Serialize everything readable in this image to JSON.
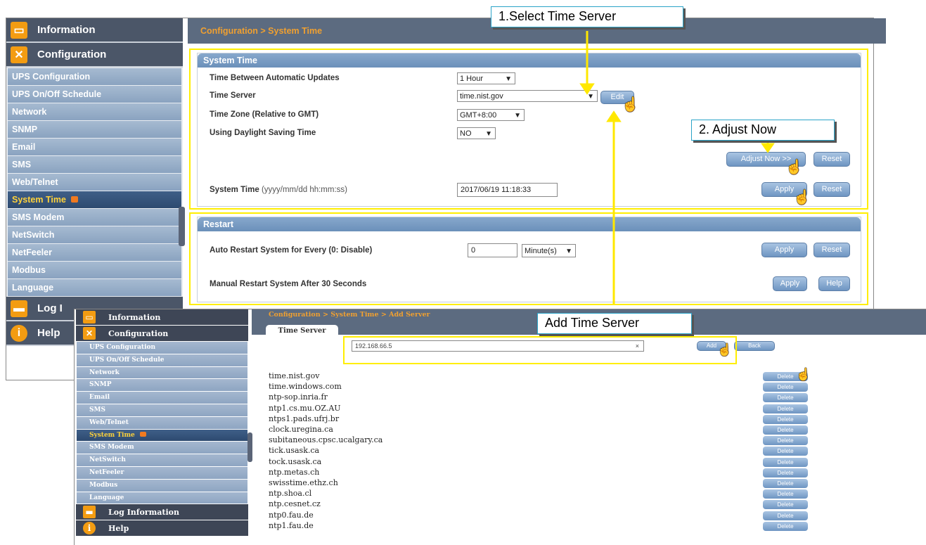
{
  "annotations": {
    "step1": "1.Select Time Server",
    "step2": "2. Adjust Now",
    "step3": "Add Time Server"
  },
  "main_window": {
    "sidebar": {
      "information": "Information",
      "configuration": "Configuration",
      "items": [
        "UPS Configuration",
        "UPS On/Off Schedule",
        "Network",
        "SNMP",
        "Email",
        "SMS",
        "Web/Telnet",
        "System Time",
        "SMS Modem",
        "NetSwitch",
        "NetFeeler",
        "Modbus",
        "Language"
      ],
      "log": "Log I",
      "help": "Help"
    },
    "breadcrumb": "Configuration > System Time",
    "system_time": {
      "title": "System Time",
      "update_label": "Time Between Automatic Updates",
      "update_value": "1 Hour",
      "server_label": "Time Server",
      "server_value": "time.nist.gov",
      "edit": "Edit",
      "zone_label": "Time Zone (Relative to GMT)",
      "zone_value": "GMT+8:00",
      "dst_label": "Using Daylight Saving Time",
      "dst_value": "NO",
      "adjust": "Adjust Now >>",
      "reset": "Reset",
      "systime_label": "System Time",
      "systime_format": "(yyyy/mm/dd hh:mm:ss)",
      "systime_value": "2017/06/19 11:18:33",
      "apply": "Apply"
    },
    "restart": {
      "title": "Restart",
      "auto_label": "Auto Restart System for Every (0: Disable)",
      "auto_value": "0",
      "unit": "Minute(s)",
      "apply": "Apply",
      "reset": "Reset",
      "manual_label": "Manual Restart System After 30 Seconds",
      "help": "Help"
    }
  },
  "add_server_window": {
    "sidebar": {
      "information": "Information",
      "configuration": "Configuration",
      "items": [
        "UPS Configuration",
        "UPS On/Off Schedule",
        "Network",
        "SNMP",
        "Email",
        "SMS",
        "Web/Telnet",
        "System Time",
        "SMS Modem",
        "NetSwitch",
        "NetFeeler",
        "Modbus",
        "Language"
      ],
      "log": "Log Information",
      "help": "Help"
    },
    "breadcrumb": "Configuration > System Time > Add Server",
    "tab": "Time Server",
    "input_value": "192.168.66.5",
    "clear": "×",
    "add": "Add",
    "back": "Back",
    "delete": "Delete",
    "servers": [
      "time.nist.gov",
      "time.windows.com",
      "ntp-sop.inria.fr",
      "ntp1.cs.mu.OZ.AU",
      "ntps1.pads.ufrj.br",
      "clock.uregina.ca",
      "subitaneous.cpsc.ucalgary.ca",
      "tick.usask.ca",
      "tock.usask.ca",
      "ntp.metas.ch",
      "swisstime.ethz.ch",
      "ntp.shoa.cl",
      "ntp.cesnet.cz",
      "ntp0.fau.de",
      "ntp1.fau.de"
    ]
  },
  "colors": {
    "highlight": "#ffee00",
    "accent": "#f0a030",
    "panel": "#6b90ba"
  }
}
